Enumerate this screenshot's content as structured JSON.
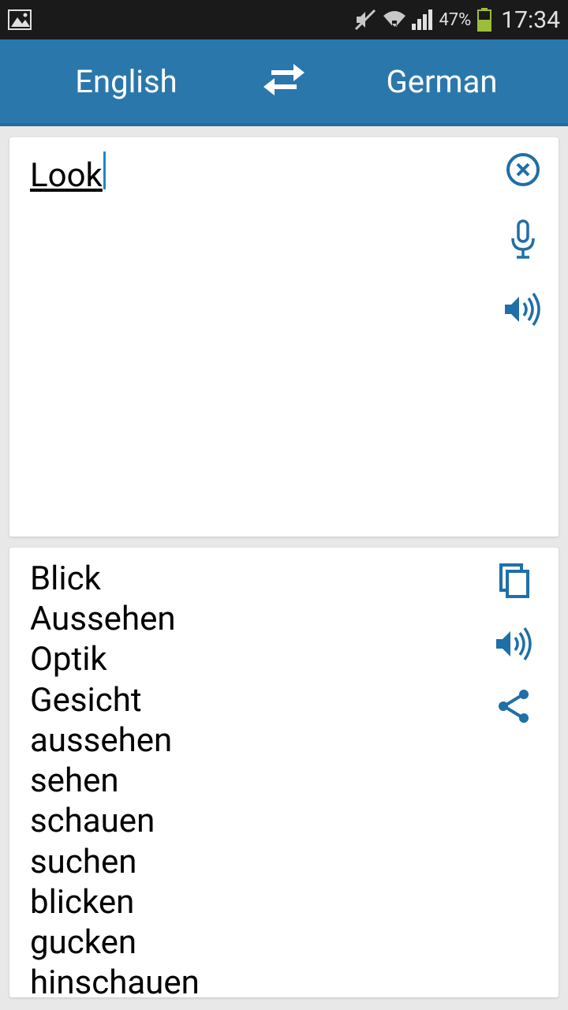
{
  "status": {
    "battery_pct": "47%",
    "time": "17:34"
  },
  "header": {
    "source_lang": "English",
    "target_lang": "German"
  },
  "input": {
    "text": "Look"
  },
  "output": {
    "translations": [
      "Blick",
      "Aussehen",
      "Optik",
      "Gesicht",
      "aussehen",
      "sehen",
      "schauen",
      "suchen",
      "blicken",
      "gucken",
      "hinschauen"
    ]
  },
  "colors": {
    "accent": "#2a77ac",
    "icon": "#1f6fa8"
  }
}
